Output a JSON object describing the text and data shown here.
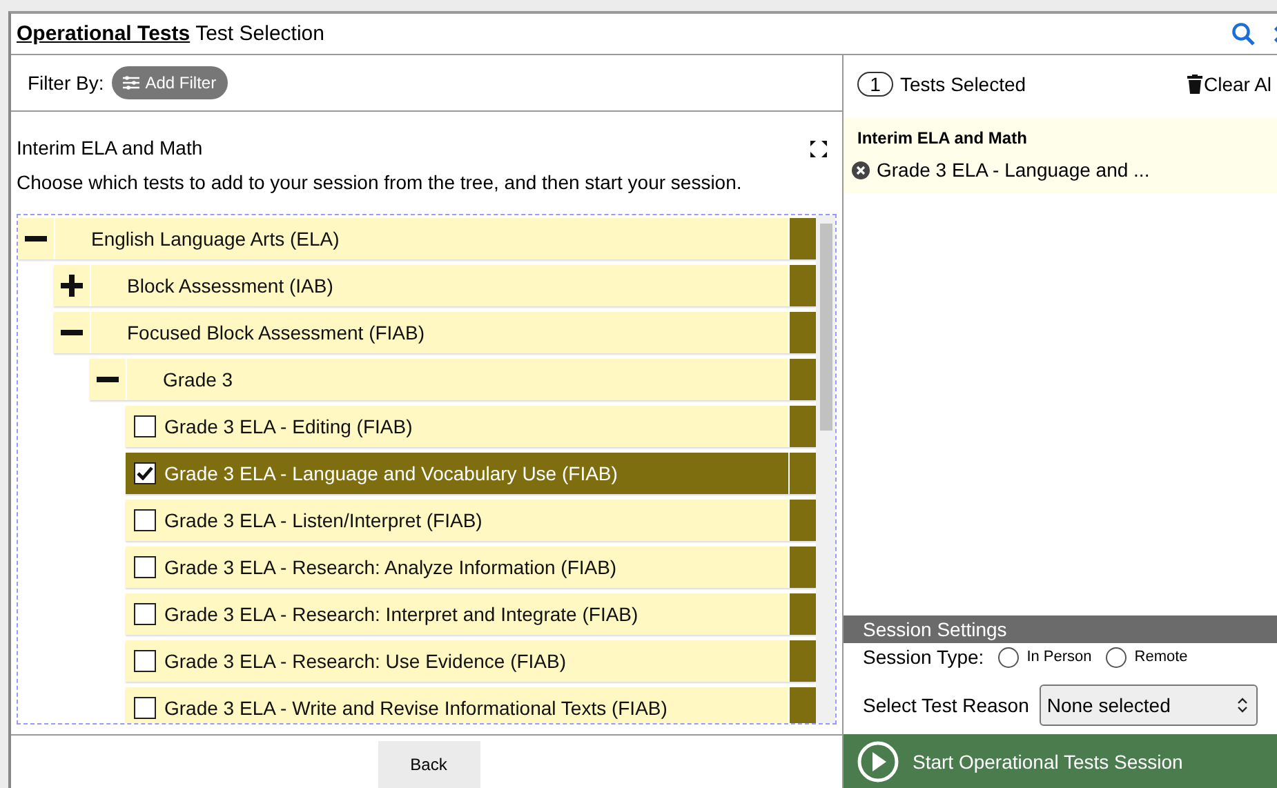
{
  "header": {
    "title_bold": "Operational Tests",
    "title": "Test Selection"
  },
  "filter": {
    "label": "Filter By:",
    "button": "Add Filter"
  },
  "description": {
    "title": "Interim ELA and Math",
    "instructions": "Choose which tests to add to your session from the tree, and then start your session."
  },
  "tree": [
    {
      "kind": "group",
      "label": "English Language Arts (ELA)",
      "expanded": true,
      "children": [
        {
          "kind": "group",
          "label": "Block Assessment (IAB)",
          "expanded": false
        },
        {
          "kind": "group",
          "label": "Focused Block Assessment (FIAB)",
          "expanded": true,
          "children": [
            {
              "kind": "group",
              "label": "Grade 3",
              "expanded": true,
              "children": [
                {
                  "kind": "test",
                  "label": "Grade 3 ELA - Editing (FIAB)",
                  "checked": false
                },
                {
                  "kind": "test",
                  "label": "Grade 3 ELA - Language and Vocabulary Use (FIAB)",
                  "checked": true
                },
                {
                  "kind": "test",
                  "label": "Grade 3 ELA - Listen/Interpret (FIAB)",
                  "checked": false
                },
                {
                  "kind": "test",
                  "label": "Grade 3 ELA - Research: Analyze Information (FIAB)",
                  "checked": false
                },
                {
                  "kind": "test",
                  "label": "Grade 3 ELA - Research: Interpret and Integrate (FIAB)",
                  "checked": false
                },
                {
                  "kind": "test",
                  "label": "Grade 3 ELA - Research: Use Evidence (FIAB)",
                  "checked": false
                },
                {
                  "kind": "test",
                  "label": "Grade 3 ELA - Write and Revise Informational Texts (FIAB)",
                  "checked": false
                }
              ]
            }
          ]
        }
      ]
    }
  ],
  "back_button": "Back",
  "selection": {
    "count": "1",
    "label": "Tests Selected",
    "clear": "Clear Al",
    "group": "Interim ELA and Math",
    "items": [
      "Grade 3 ELA - Language and ..."
    ]
  },
  "session_settings": {
    "title": "Session Settings",
    "type_label": "Session Type:",
    "types": [
      {
        "label": "In Person",
        "selected": false
      },
      {
        "label": "Remote",
        "selected": false
      }
    ],
    "reason_label": "Select Test Reason",
    "reason_value": "None selected"
  },
  "start_button": "Start Operational Tests Session"
}
